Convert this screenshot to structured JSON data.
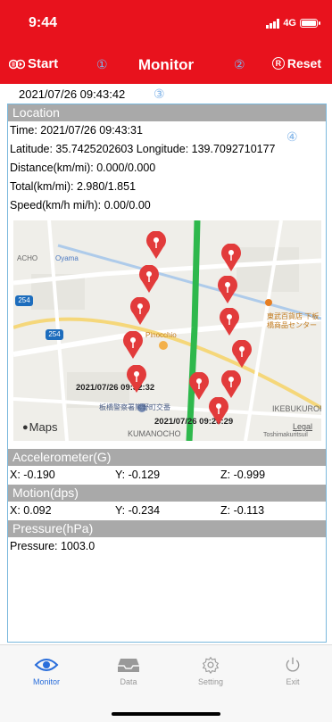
{
  "status": {
    "time": "9:44",
    "network": "4G"
  },
  "navbar": {
    "start_label": "Start",
    "title": "Monitor",
    "reset_label": "Reset",
    "marker_1": "①",
    "marker_2": "②",
    "marker_3": "③",
    "marker_4": "④"
  },
  "current_datetime": "2021/07/26 09:43:42",
  "location": {
    "header": "Location",
    "time": "Time: 2021/07/26 09:43:31",
    "latlon": "Latitude: 35.7425202603 Longitude: 139.7092710177",
    "distance": "Distance(km/mi): 0.000/0.000",
    "total": "Total(km/mi): 2.980/1.851",
    "speed": "Speed(km/h mi/h): 0.00/0.00"
  },
  "map": {
    "label_acho": "ACHO",
    "label_oyama": "Oyama",
    "route_254_a": "254",
    "route_254_b": "254",
    "label_pinocchio": "Pinocchio",
    "label_store_1": "東武百貨店 下板",
    "label_store_2": "橋商品センター",
    "timestamp_1": "2021/07/26 09:32:32",
    "label_police": "板橋警察署熊野町交番",
    "timestamp_2": "2021/07/26 09:28:29",
    "label_ikebukuro": "IKEBUKUROHON",
    "label_kumano": "KUMANOCHO",
    "label_toshima": "Toshimakuritsuil",
    "maps_brand": "Maps",
    "legal": "Legal",
    "accent_pin": "#e23b3b"
  },
  "accelerometer": {
    "header": "Accelerometer(G)",
    "x": "X: -0.190",
    "y": "Y: -0.129",
    "z": "Z: -0.999"
  },
  "motion": {
    "header": "Motion(dps)",
    "x": "X: 0.092",
    "y": "Y: -0.234",
    "z": "Z: -0.113"
  },
  "pressure": {
    "header": "Pressure(hPa)",
    "value": "Pressure: 1003.0"
  },
  "tabs": [
    {
      "label": "Monitor",
      "icon": "eye-icon",
      "active": true
    },
    {
      "label": "Data",
      "icon": "inbox-icon",
      "active": false
    },
    {
      "label": "Setting",
      "icon": "gear-icon",
      "active": false
    },
    {
      "label": "Exit",
      "icon": "power-icon",
      "active": false
    }
  ],
  "colors": {
    "brand": "#e8121d",
    "active_tab": "#2a6edb",
    "section_header": "#a9a9a9"
  }
}
